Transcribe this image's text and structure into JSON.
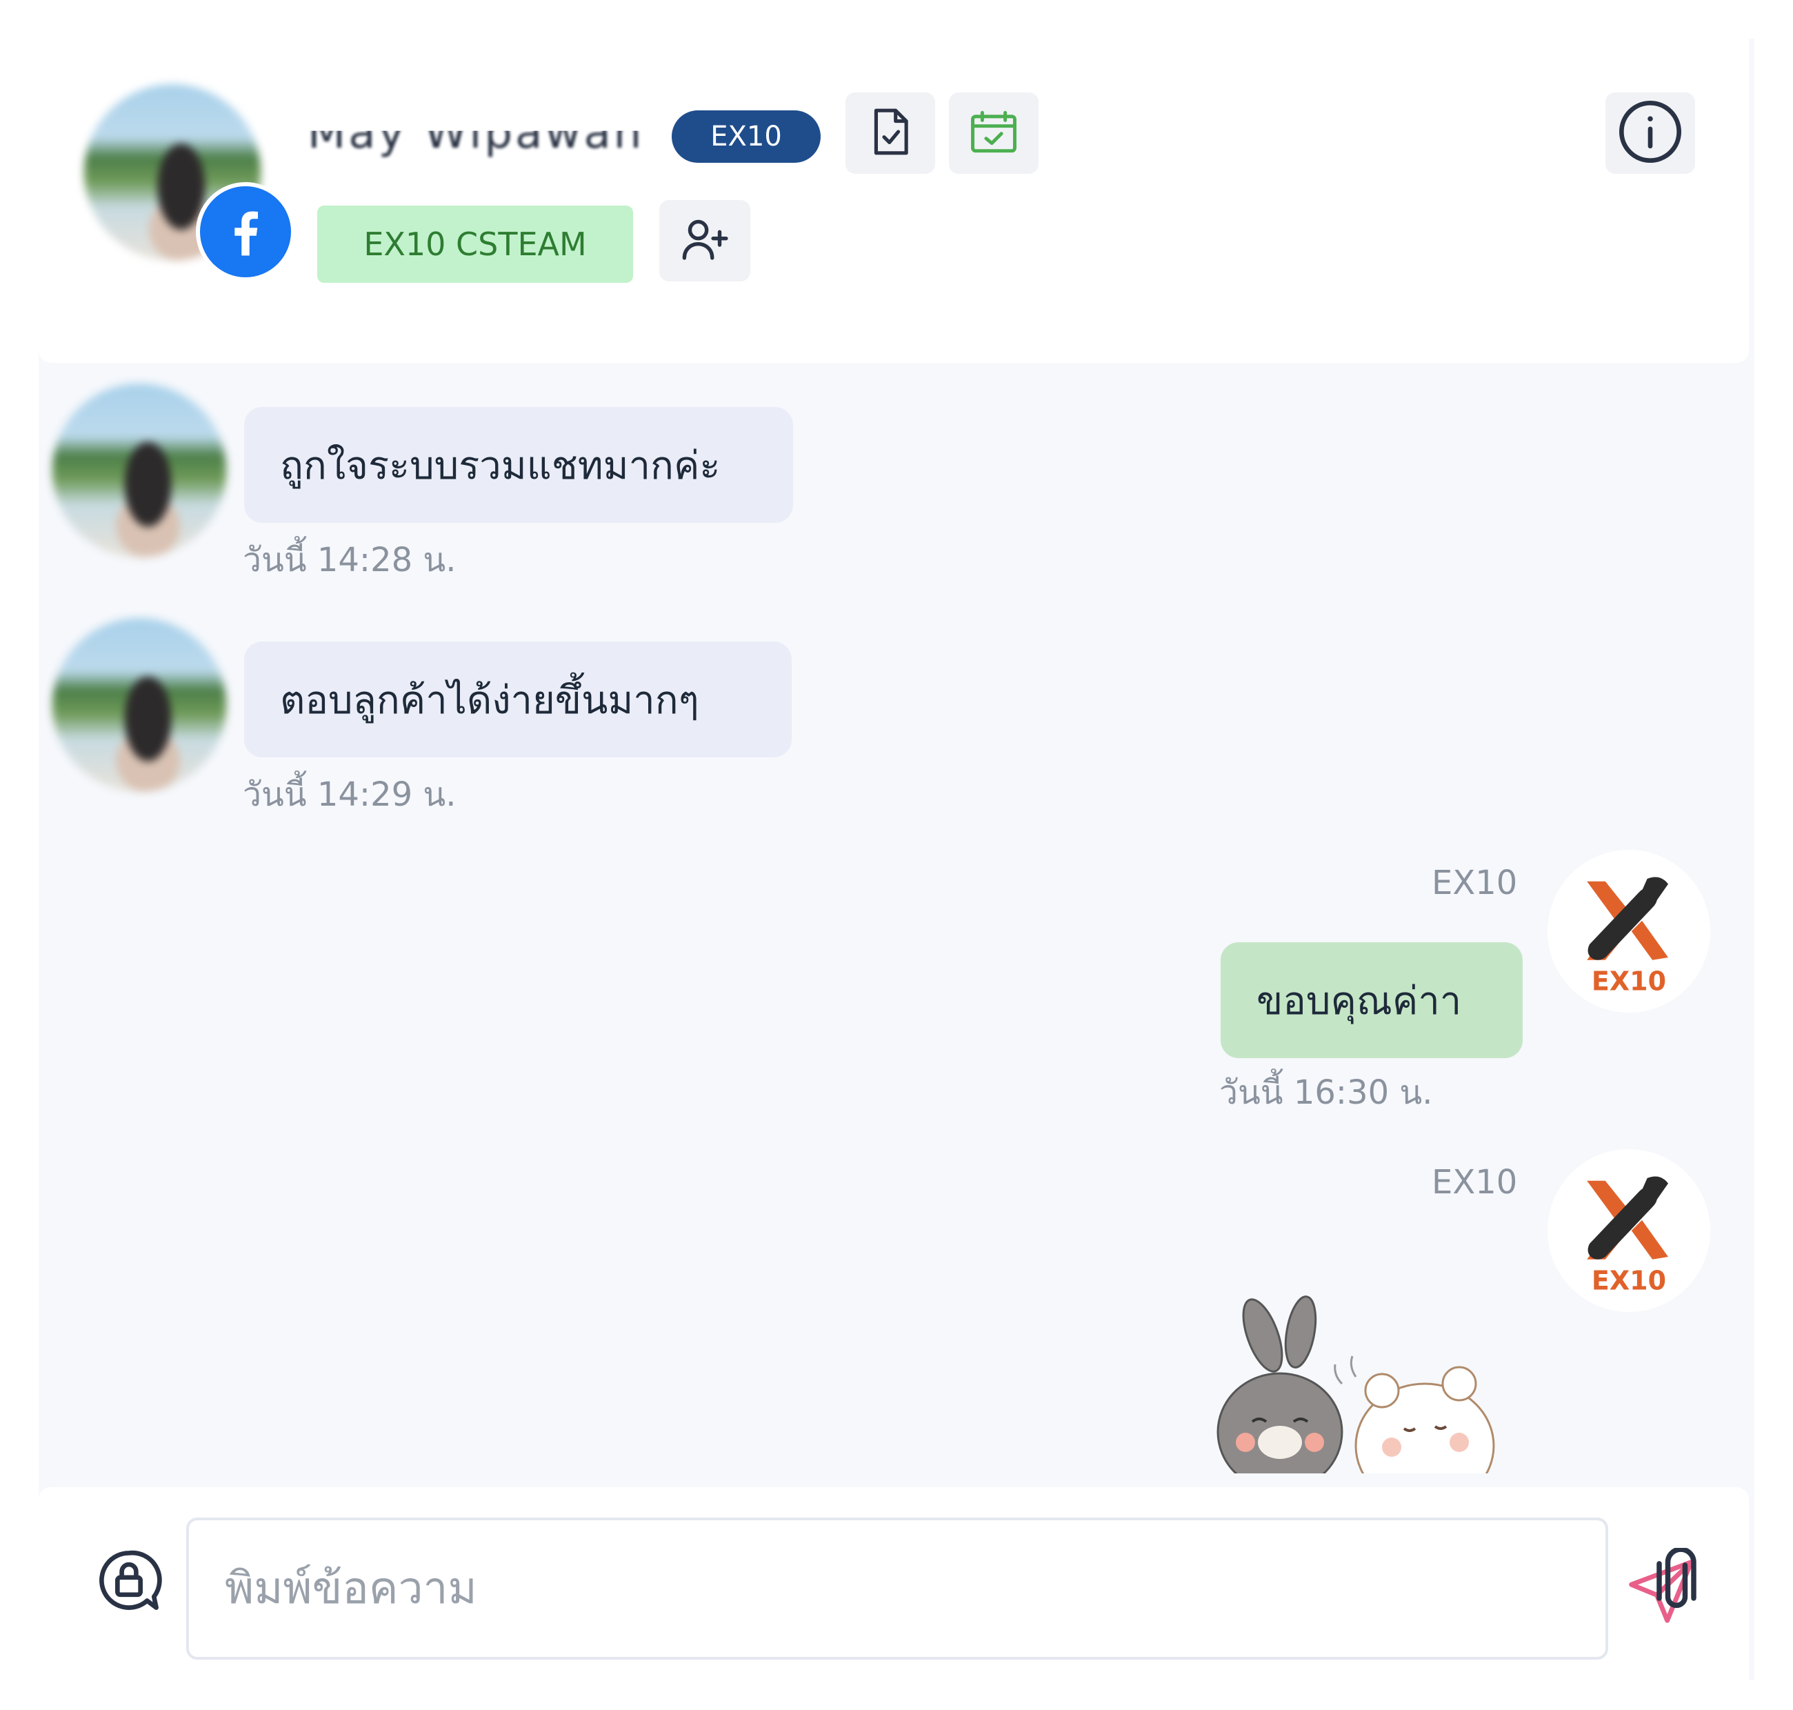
{
  "header": {
    "contact_name": "May Wipawan",
    "channel_badge": "EX10",
    "team_tag": "EX10 CSTEAM",
    "icons": [
      "document-check-icon",
      "calendar-check-icon",
      "add-user-icon",
      "info-icon",
      "facebook-icon"
    ]
  },
  "messages": [
    {
      "direction": "in",
      "text": "ถูกใจระบบรวมแชทมากค่ะ",
      "time": "วันนี้ 14:28 น."
    },
    {
      "direction": "in",
      "text": "ตอบลูกค้าได้ง่ายขึ้นมากๆ",
      "time": "วันนี้ 14:29 น."
    },
    {
      "direction": "out",
      "sender": "EX10",
      "text": "ขอบคุณค่าา",
      "time": "วันนี้ 16:30 น."
    },
    {
      "direction": "out",
      "sender": "EX10",
      "type": "sticker"
    }
  ],
  "brand": {
    "logo_text": "EX10",
    "color_dark": "#2b2b2b",
    "color_accent": "#e0622a"
  },
  "composer": {
    "placeholder": "พิมพ์ข้อความ",
    "icons": [
      "private-note-icon",
      "send-icon",
      "attach-icon"
    ]
  },
  "colors": {
    "badge": "#1f4d8c",
    "team_tag_bg": "#c2f2cc",
    "team_tag_text": "#2e7d32",
    "incoming_bubble": "#eaedf7",
    "outgoing_bubble": "#c5e6c6",
    "send_icon": "#e8608a"
  }
}
